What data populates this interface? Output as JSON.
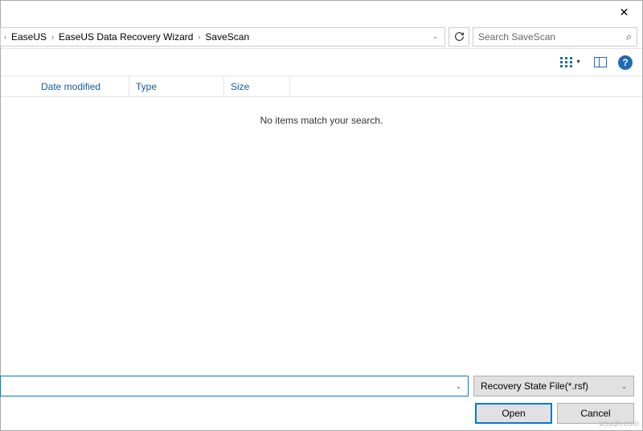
{
  "titlebar": {
    "close": "✕"
  },
  "breadcrumb": {
    "items": [
      "EaseUS",
      "EaseUS Data Recovery Wizard",
      "SaveScan"
    ]
  },
  "search": {
    "placeholder": "Search SaveScan"
  },
  "columns": {
    "c1": "Date modified",
    "c2": "Type",
    "c3": "Size"
  },
  "content": {
    "empty": "No items match your search."
  },
  "filter": {
    "filetype": "Recovery State File(*.rsf)"
  },
  "buttons": {
    "open": "Open",
    "cancel": "Cancel"
  },
  "watermark": "wsxdn.com"
}
